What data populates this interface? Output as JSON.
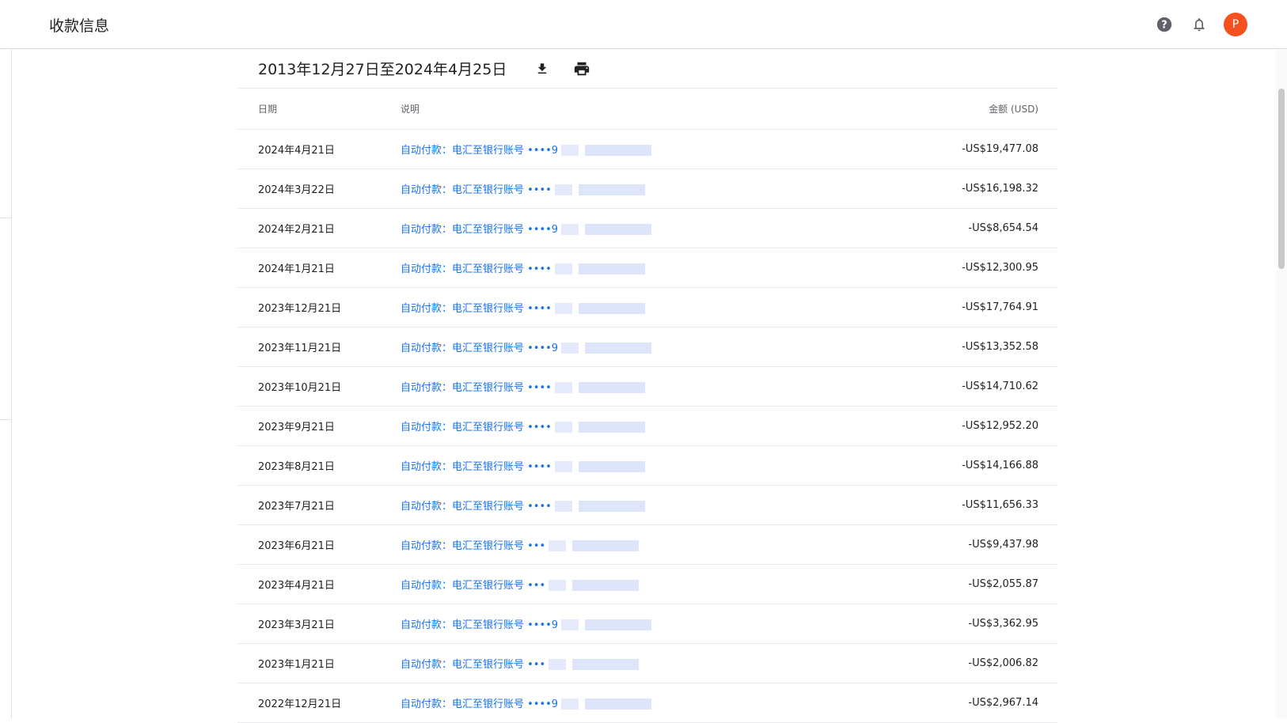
{
  "header": {
    "title": "收款信息",
    "avatar_letter": "P",
    "icons": [
      "help-icon",
      "bell-icon"
    ]
  },
  "statement": {
    "date_range": "2013年12月27日至2024年4月25日",
    "download_icon": "download-icon",
    "print_icon": "print-icon"
  },
  "table": {
    "headers": {
      "date": "日期",
      "description": "说明",
      "amount": "金额 (USD)"
    },
    "rows": [
      {
        "date": "2024年4月21日",
        "description": "自动付款：电汇至银行账号 ••••9",
        "amount": "-US$19,477.08"
      },
      {
        "date": "2024年3月22日",
        "description": "自动付款：电汇至银行账号 ••••",
        "amount": "-US$16,198.32"
      },
      {
        "date": "2024年2月21日",
        "description": "自动付款：电汇至银行账号 ••••9",
        "amount": "-US$8,654.54"
      },
      {
        "date": "2024年1月21日",
        "description": "自动付款：电汇至银行账号 ••••",
        "amount": "-US$12,300.95"
      },
      {
        "date": "2023年12月21日",
        "description": "自动付款：电汇至银行账号 ••••",
        "amount": "-US$17,764.91"
      },
      {
        "date": "2023年11月21日",
        "description": "自动付款：电汇至银行账号 ••••9",
        "amount": "-US$13,352.58"
      },
      {
        "date": "2023年10月21日",
        "description": "自动付款：电汇至银行账号 ••••",
        "amount": "-US$14,710.62"
      },
      {
        "date": "2023年9月21日",
        "description": "自动付款：电汇至银行账号 ••••",
        "amount": "-US$12,952.20"
      },
      {
        "date": "2023年8月21日",
        "description": "自动付款：电汇至银行账号 ••••",
        "amount": "-US$14,166.88"
      },
      {
        "date": "2023年7月21日",
        "description": "自动付款：电汇至银行账号 ••••",
        "amount": "-US$11,656.33"
      },
      {
        "date": "2023年6月21日",
        "description": "自动付款：电汇至银行账号 •••",
        "amount": "-US$9,437.98"
      },
      {
        "date": "2023年4月21日",
        "description": "自动付款：电汇至银行账号 •••",
        "amount": "-US$2,055.87"
      },
      {
        "date": "2023年3月21日",
        "description": "自动付款：电汇至银行账号 ••••9",
        "amount": "-US$3,362.95"
      },
      {
        "date": "2023年1月21日",
        "description": "自动付款：电汇至银行账号 •••",
        "amount": "-US$2,006.82"
      },
      {
        "date": "2022年12月21日",
        "description": "自动付款：电汇至银行账号 ••••9",
        "amount": "-US$2,967.14"
      }
    ]
  }
}
